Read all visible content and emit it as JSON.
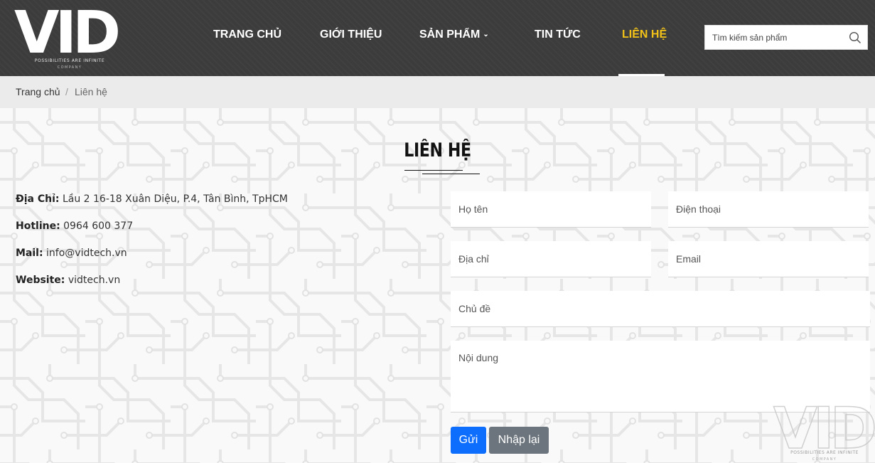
{
  "header": {
    "logo_text": "VID",
    "logo_tagline": "POSSIBILITIES ARE INFINITE",
    "logo_subtag": "COMPANY",
    "nav": [
      {
        "label": "TRANG CHỦ",
        "active": false
      },
      {
        "label": "GIỚI THIỆU",
        "active": false
      },
      {
        "label": "SẢN PHẨM",
        "active": false,
        "has_dropdown": true
      },
      {
        "label": "TIN TỨC",
        "active": false
      },
      {
        "label": "LIÊN HỆ",
        "active": true
      }
    ],
    "dropdown_caret": "⌄",
    "search_placeholder": "Tìm kiếm sản phẩm",
    "colors": {
      "background": "#3c3c3c",
      "active_nav": "#f2c218",
      "nav": "#ffffff"
    }
  },
  "breadcrumb": {
    "home": "Trang chủ",
    "separator": "/",
    "current": "Liên hệ"
  },
  "contact": {
    "title": "LIÊN HỆ",
    "info": [
      {
        "label": "Địa Chỉ:",
        "value": "Lầu 2 16-18 Xuân Diệu, P.4, Tân Bình, TpHCM"
      },
      {
        "label": "Hotline:",
        "value": "0964 600 377"
      },
      {
        "label": "Mail:",
        "value": "info@vidtech.vn"
      },
      {
        "label": "Website:",
        "value": "vidtech.vn"
      }
    ],
    "form": {
      "name_placeholder": "Họ tên",
      "phone_placeholder": "Điện thoại",
      "address_placeholder": "Địa chỉ",
      "email_placeholder": "Email",
      "subject_placeholder": "Chủ đề",
      "message_placeholder": "Nội dung",
      "send_label": "Gửi",
      "reset_label": "Nhập lại"
    },
    "colors": {
      "send_button": "#0d6efd",
      "reset_button": "#6c757d"
    }
  },
  "watermark": {
    "text": "VID",
    "tagline": "POSSIBILITIES ARE INFINITE",
    "subtag": "COMPANY"
  }
}
